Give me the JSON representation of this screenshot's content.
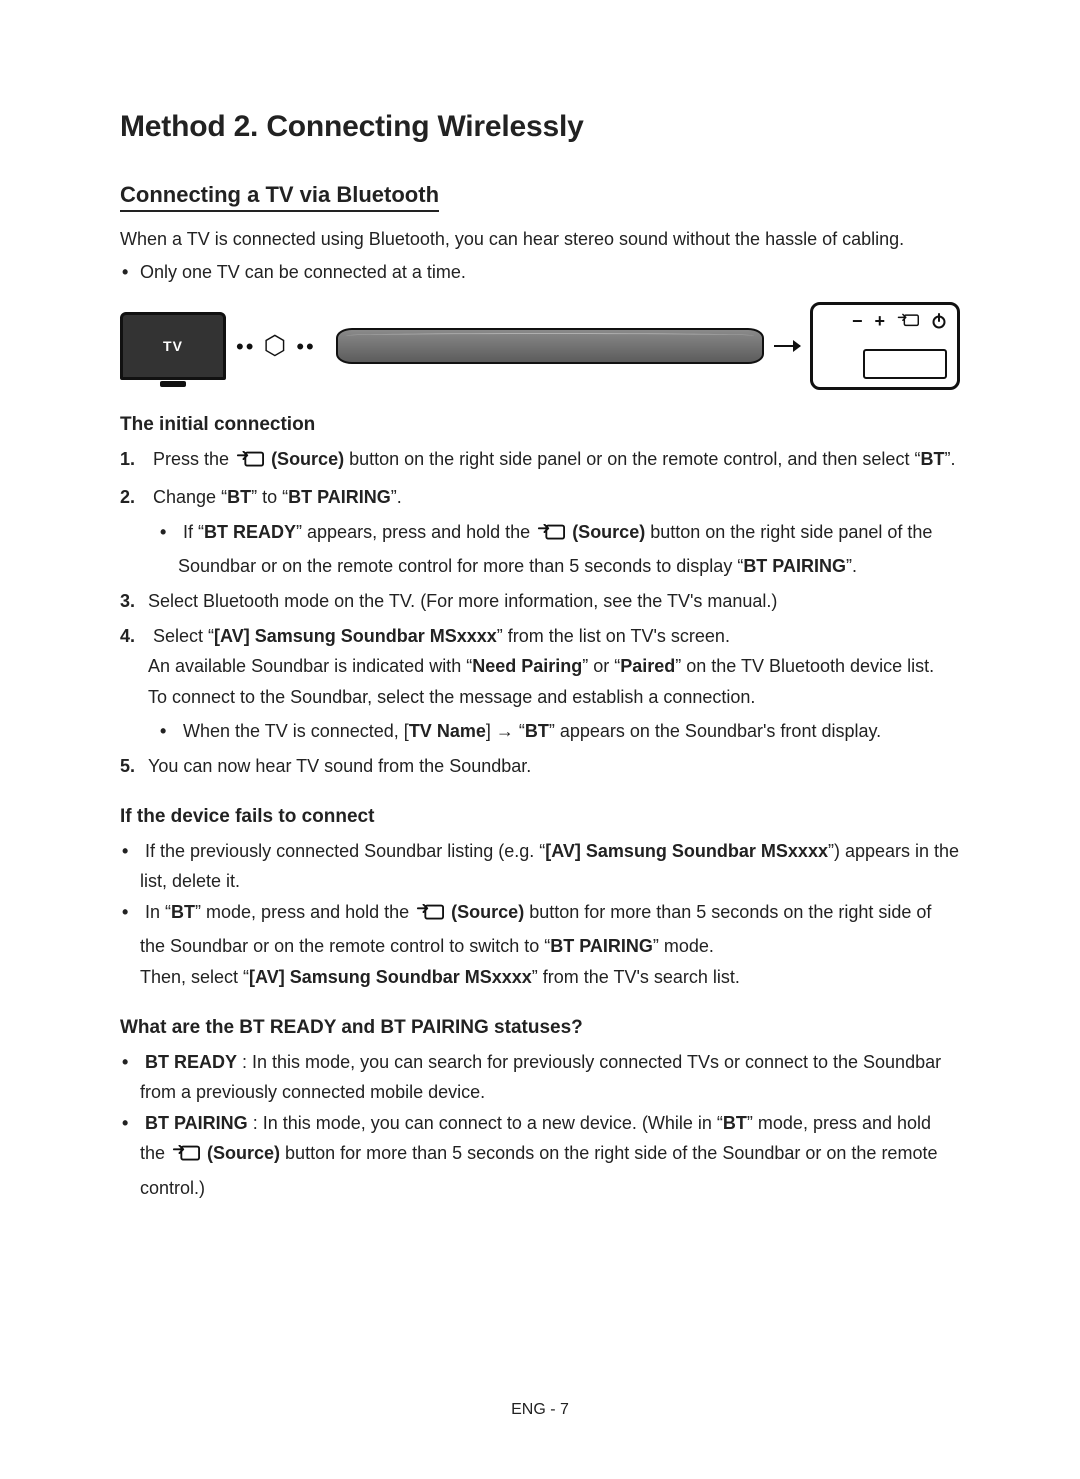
{
  "h1": "Method 2. Connecting Wirelessly",
  "h2": "Connecting a TV via Bluetooth",
  "intro": "When a TV is connected using Bluetooth, you can hear stereo sound without the hassle of cabling.",
  "intro_b1": "Only one TV can be connected at a time.",
  "diagram": {
    "tv_label": "TV",
    "bt_dots": "•• ✱ ••"
  },
  "h3_initial": "The initial connection",
  "step1_a": "Press the ",
  "step1_src": " (Source)",
  "step1_b": " button on the right side panel or on the remote control, and then select “",
  "step1_bt": "BT",
  "step1_c": "”.",
  "step2_a": "Change “",
  "step2_bt": "BT",
  "step2_b": "” to “",
  "step2_btp": "BT PAIRING",
  "step2_c": "”.",
  "step2_sub_a": "If “",
  "step2_sub_ready": "BT READY",
  "step2_sub_b": "” appears, press and hold the ",
  "step2_sub_src": " (Source)",
  "step2_sub_c": " button on the right side panel of the Soundbar or on the remote control for more than 5 seconds to display “",
  "step2_sub_btp": "BT PAIRING",
  "step2_sub_d": "”.",
  "step3": "Select Bluetooth mode on the TV. (For more information, see the TV's manual.)",
  "step4_a": "Select “",
  "step4_dev": "[AV] Samsung Soundbar MSxxxx",
  "step4_b": "” from the list on TV's screen.",
  "step4_l2a": "An available Soundbar is indicated with “",
  "step4_np": "Need Pairing",
  "step4_l2b": "” or “",
  "step4_paired": "Paired",
  "step4_l2c": "” on the TV Bluetooth device list.",
  "step4_l3": "To connect to the Soundbar, select the message and establish a connection.",
  "step4_sub_a": "When the TV is connected, [",
  "step4_sub_tvn": "TV Name",
  "step4_sub_b": "] → “",
  "step4_sub_bt": "BT",
  "step4_sub_c": "” appears on the Soundbar's front display.",
  "step5": "You can now hear TV sound from the Soundbar.",
  "h3_fail": "If the device fails to connect",
  "fail1_a": "If the previously connected Soundbar listing (e.g. “",
  "fail1_dev": "[AV] Samsung Soundbar MSxxxx",
  "fail1_b": "”) appears in the list, delete it.",
  "fail2_a": "In “",
  "fail2_bt": "BT",
  "fail2_b": "” mode, press and hold the ",
  "fail2_src": " (Source)",
  "fail2_c": " button for more than 5 seconds on the right side of the Soundbar or on the remote control to switch to “",
  "fail2_btp": "BT PAIRING",
  "fail2_d": "” mode.",
  "fail2_l2a": "Then, select “",
  "fail2_l2dev": "[AV] Samsung Soundbar MSxxxx",
  "fail2_l2b": "” from the TV's search list.",
  "h3_status": "What are the BT READY and BT PAIRING statuses?",
  "stat1_a": "BT READY",
  "stat1_b": " : In this mode, you can search for previously connected TVs or connect to the Soundbar from a previously connected mobile device.",
  "stat2_a": "BT PAIRING",
  "stat2_b": " : In this mode, you can connect to a new device. (While in “",
  "stat2_bt": "BT",
  "stat2_c": "” mode, press and hold the ",
  "stat2_src": " (Source)",
  "stat2_d": " button for more than 5 seconds on the right side of the Soundbar or on the remote control.)",
  "footer": "ENG - 7"
}
